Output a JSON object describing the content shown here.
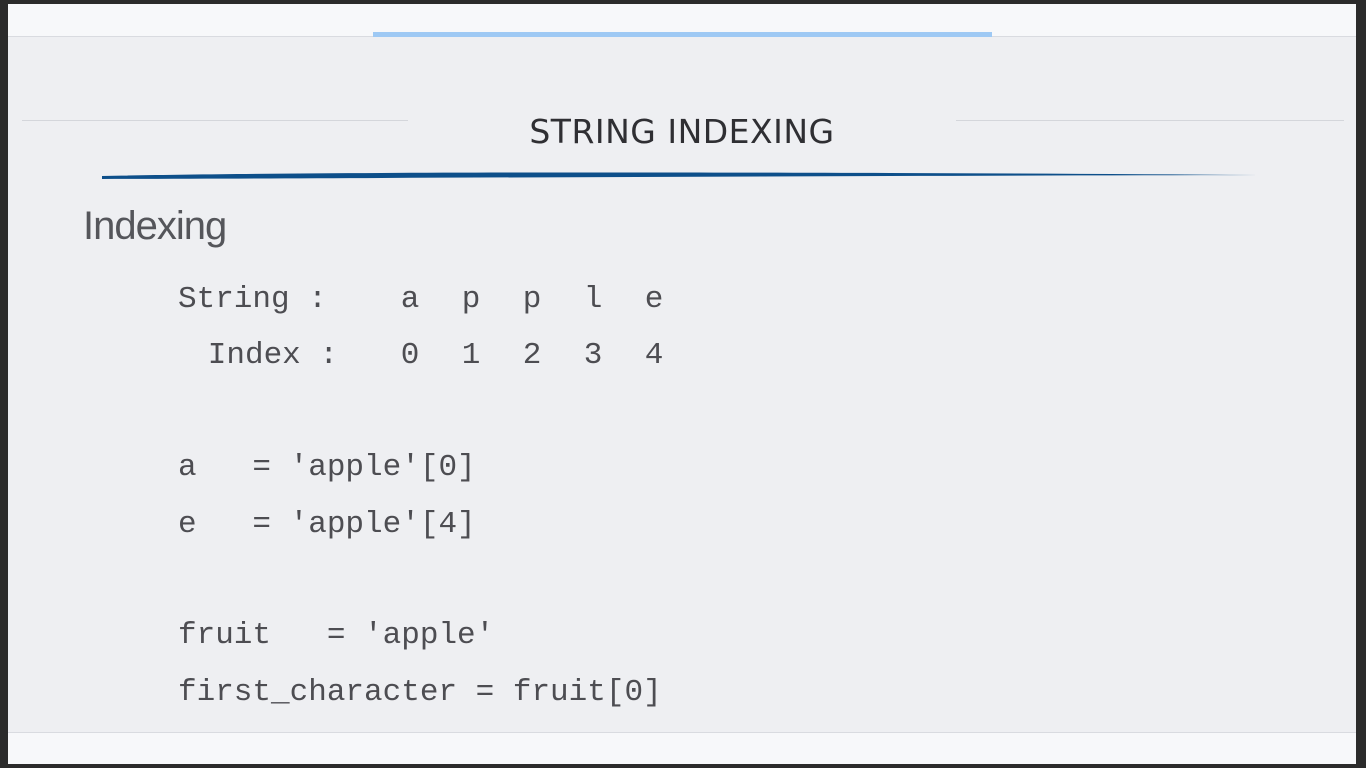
{
  "slide": {
    "title": "STRING INDEXING",
    "heading": "Indexing",
    "progress": 1.0
  },
  "index_table": {
    "string_label": "String :",
    "index_label": "Index :",
    "chars": [
      "a",
      "p",
      "p",
      "l",
      "e"
    ],
    "indices": [
      "0",
      "1",
      "2",
      "3",
      "4"
    ]
  },
  "code_lines": [
    "a   = 'apple'[0]",
    "e   = 'apple'[4]",
    "fruit   = 'apple'",
    "first_character = fruit[0]"
  ],
  "colors": {
    "accent_progress": "#9ec9f4",
    "swoosh": "#0d4f8a",
    "background": "#eeeff2"
  }
}
